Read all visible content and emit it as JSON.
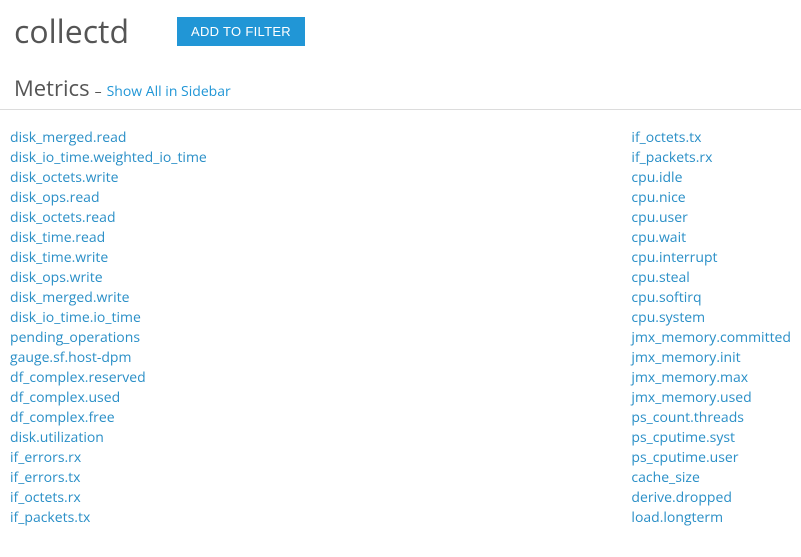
{
  "header": {
    "title": "collectd",
    "add_filter_label": "ADD TO FILTER"
  },
  "section": {
    "title": "Metrics",
    "dash": "–",
    "link_label": "Show All in Sidebar"
  },
  "metrics": {
    "left": [
      "disk_merged.read",
      "disk_io_time.weighted_io_time",
      "disk_octets.write",
      "disk_ops.read",
      "disk_octets.read",
      "disk_time.read",
      "disk_time.write",
      "disk_ops.write",
      "disk_merged.write",
      "disk_io_time.io_time",
      "pending_operations",
      "gauge.sf.host-dpm",
      "df_complex.reserved",
      "df_complex.used",
      "df_complex.free",
      "disk.utilization",
      "if_errors.rx",
      "if_errors.tx",
      "if_octets.rx",
      "if_packets.tx"
    ],
    "right": [
      "if_octets.tx",
      "if_packets.rx",
      "cpu.idle",
      "cpu.nice",
      "cpu.user",
      "cpu.wait",
      "cpu.interrupt",
      "cpu.steal",
      "cpu.softirq",
      "cpu.system",
      "jmx_memory.committed",
      "jmx_memory.init",
      "jmx_memory.max",
      "jmx_memory.used",
      "ps_count.threads",
      "ps_cputime.syst",
      "ps_cputime.user",
      "cache_size",
      "derive.dropped",
      "load.longterm"
    ]
  }
}
